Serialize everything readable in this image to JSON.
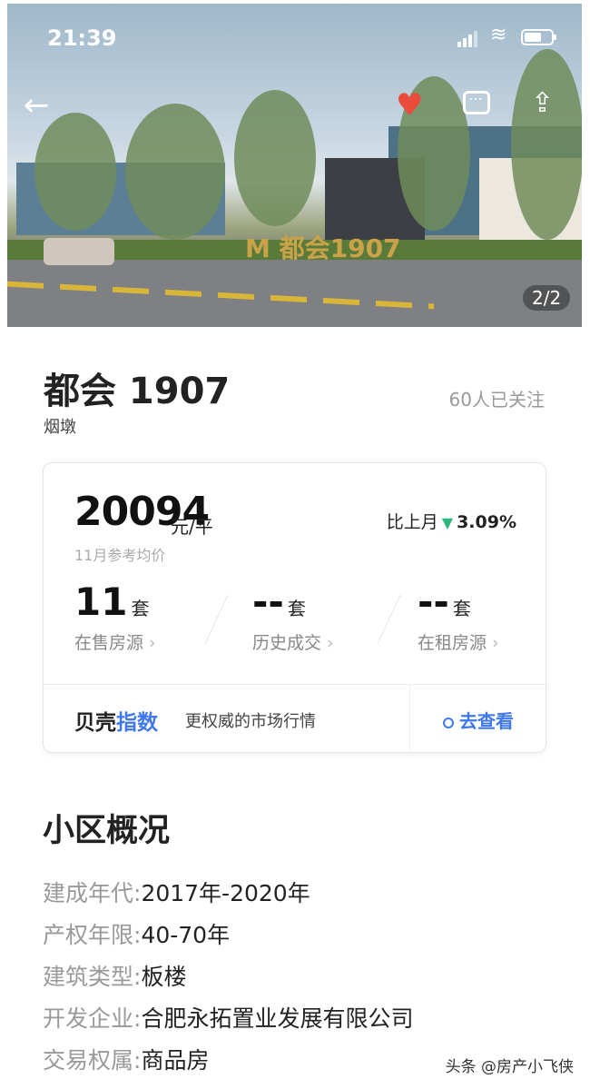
{
  "status_bar": {
    "time": "21:39"
  },
  "hero": {
    "sign_text": "M 都会1907",
    "pager": "2/2"
  },
  "community": {
    "name": "都会 1907",
    "area": "烟墩",
    "followers": "60人已关注"
  },
  "price_card": {
    "price": "20094",
    "unit": "元/平",
    "caption": "11月参考均价",
    "mom_label": "比上月",
    "mom_value": "3.09%",
    "stats": [
      {
        "value": "11",
        "unit": "套",
        "label": "在售房源"
      },
      {
        "value": "--",
        "unit": "套",
        "label": "历史成交"
      },
      {
        "value": "--",
        "unit": "套",
        "label": "在租房源"
      }
    ],
    "index_brand_a": "贝壳",
    "index_brand_b": "指数",
    "index_desc": "更权威的市场行情",
    "index_link": "去查看"
  },
  "overview": {
    "title": "小区概况",
    "rows": [
      {
        "key": "建成年代:",
        "value": "2017年-2020年"
      },
      {
        "key": "产权年限:",
        "value": "40-70年"
      },
      {
        "key": "建筑类型:",
        "value": "板楼"
      },
      {
        "key": "开发企业:",
        "value": "合肥永拓置业发展有限公司"
      },
      {
        "key": "交易权属:",
        "value": "商品房"
      }
    ]
  },
  "watermark": "头条 @房产小飞侠",
  "colors": {
    "accent": "#3f78ec",
    "down": "#2fb67c",
    "heart": "#ea4b3b"
  },
  "icons": [
    "back-arrow-icon",
    "heart-icon",
    "comment-icon",
    "share-icon",
    "signal-icon",
    "wifi-icon",
    "battery-icon",
    "down-triangle-icon",
    "chevron-right-icon"
  ]
}
